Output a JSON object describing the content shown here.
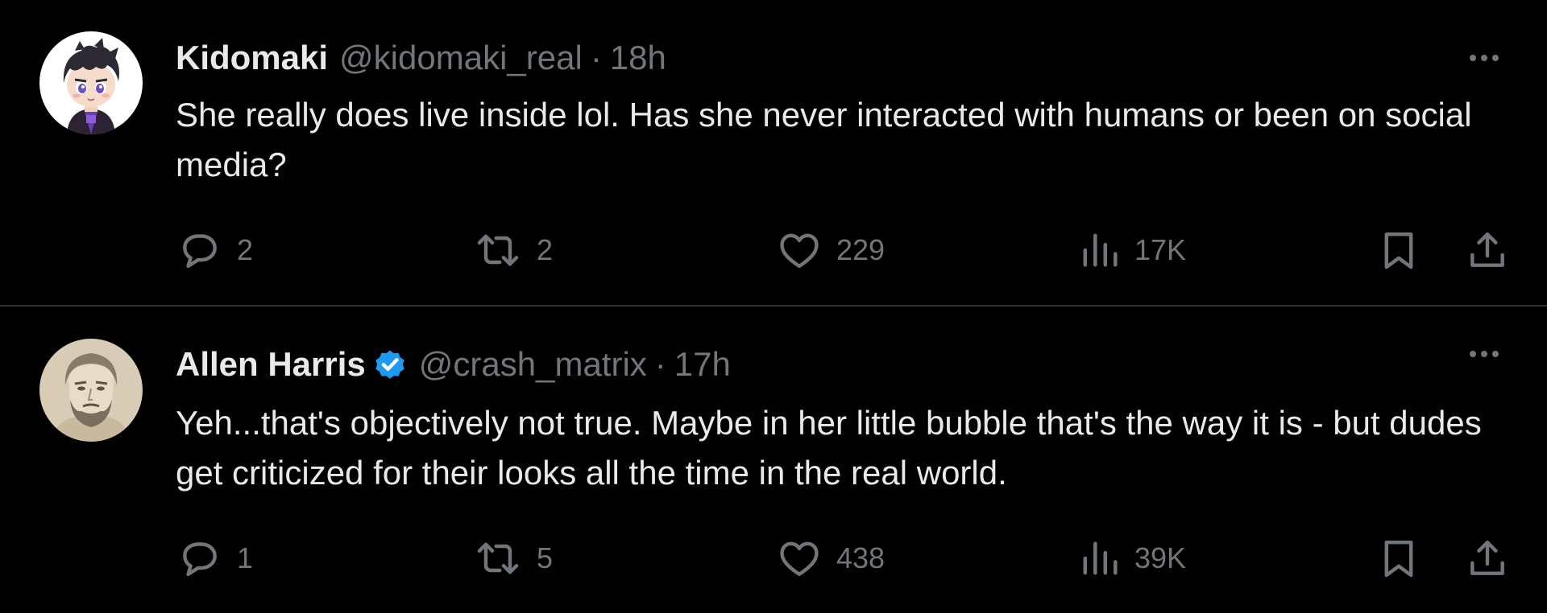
{
  "tweets": [
    {
      "name": "Kidomaki",
      "handle": "@kidomaki_real",
      "separator": "·",
      "time": "18h",
      "verified": false,
      "text": "She really does live inside lol. Has she never interacted with humans or been on social media?",
      "stats": {
        "replies": "2",
        "retweets": "2",
        "likes": "229",
        "views": "17K"
      },
      "avatar_icon": "anime-avatar-icon"
    },
    {
      "name": "Allen Harris",
      "handle": "@crash_matrix",
      "separator": "·",
      "time": "17h",
      "verified": true,
      "text": "Yeh...that's objectively not true. Maybe in her little bubble that's the way it is - but dudes get criticized for their looks all the time in the real world.",
      "stats": {
        "replies": "1",
        "retweets": "5",
        "likes": "438",
        "views": "39K"
      },
      "avatar_icon": "sketch-portrait-icon"
    }
  ],
  "colors": {
    "background": "#000000",
    "primary_text": "#e7e9ea",
    "secondary_text": "#71767b",
    "divider": "#2f3336",
    "verified_badge": "#1d9bf0"
  },
  "icons": {
    "reply": "reply-bubble-icon",
    "retweet": "retweet-arrows-icon",
    "like": "heart-icon",
    "views": "bar-chart-icon",
    "bookmark": "bookmark-icon",
    "share": "share-upload-icon",
    "more": "more-dots-icon",
    "verified": "verified-badge-icon"
  }
}
